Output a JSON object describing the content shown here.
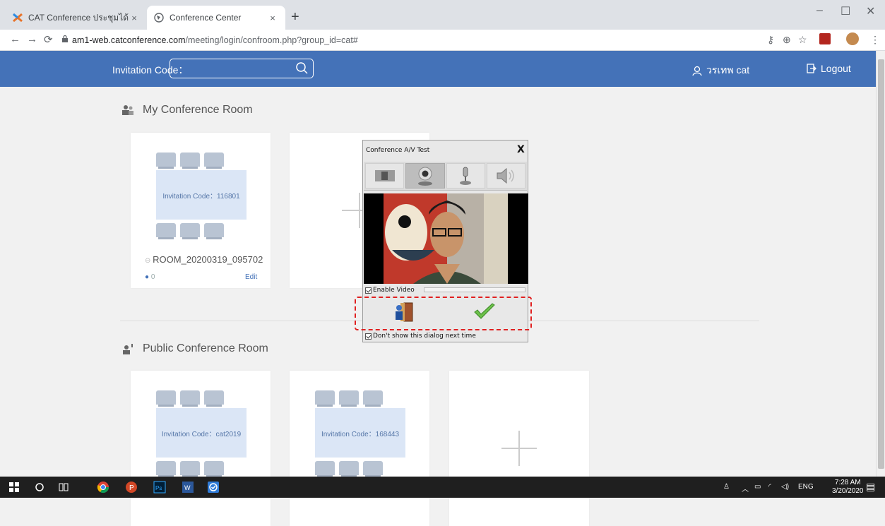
{
  "browser": {
    "tabs": [
      {
        "title": "CAT Conference ประชุมได้ใช้ชัดจำกั",
        "active": false
      },
      {
        "title": "Conference Center",
        "active": true
      }
    ],
    "tab_close": "×",
    "new_tab": "+",
    "url_host": "am1-web.catconference.com",
    "url_path": "/meeting/login/confroom.php?group_id=cat#"
  },
  "header": {
    "invitation_label": "Invitation Code：",
    "invitation_value": "",
    "user_name": "วรเทพ cat",
    "logout_label": "Logout"
  },
  "my_rooms": {
    "title": "My Conference Room",
    "rooms": [
      {
        "invitation": "Invitation Code：116801",
        "name": "ROOM_20200319_095702",
        "participants": "0",
        "edit_label": "Edit"
      }
    ]
  },
  "public_rooms": {
    "title": "Public Conference Room",
    "rooms": [
      {
        "invitation": "Invitation Code：cat2019"
      },
      {
        "invitation": "Invitation Code：168443"
      }
    ]
  },
  "dialog": {
    "title": "Conference A/V Test",
    "close": "X",
    "tabs": [
      "screen-icon",
      "camera-icon",
      "microphone-icon",
      "speaker-icon"
    ],
    "active_tab": 1,
    "enable_video_label": "Enable Video",
    "enable_video_checked": true,
    "dont_show_label": "Don't show this dialog next time",
    "dont_show_checked": true
  },
  "taskbar": {
    "lang": "ENG",
    "time": "7:28 AM",
    "date": "3/20/2020"
  },
  "colors": {
    "brand_blue": "#4472b8",
    "highlight_red": "#e02020"
  }
}
